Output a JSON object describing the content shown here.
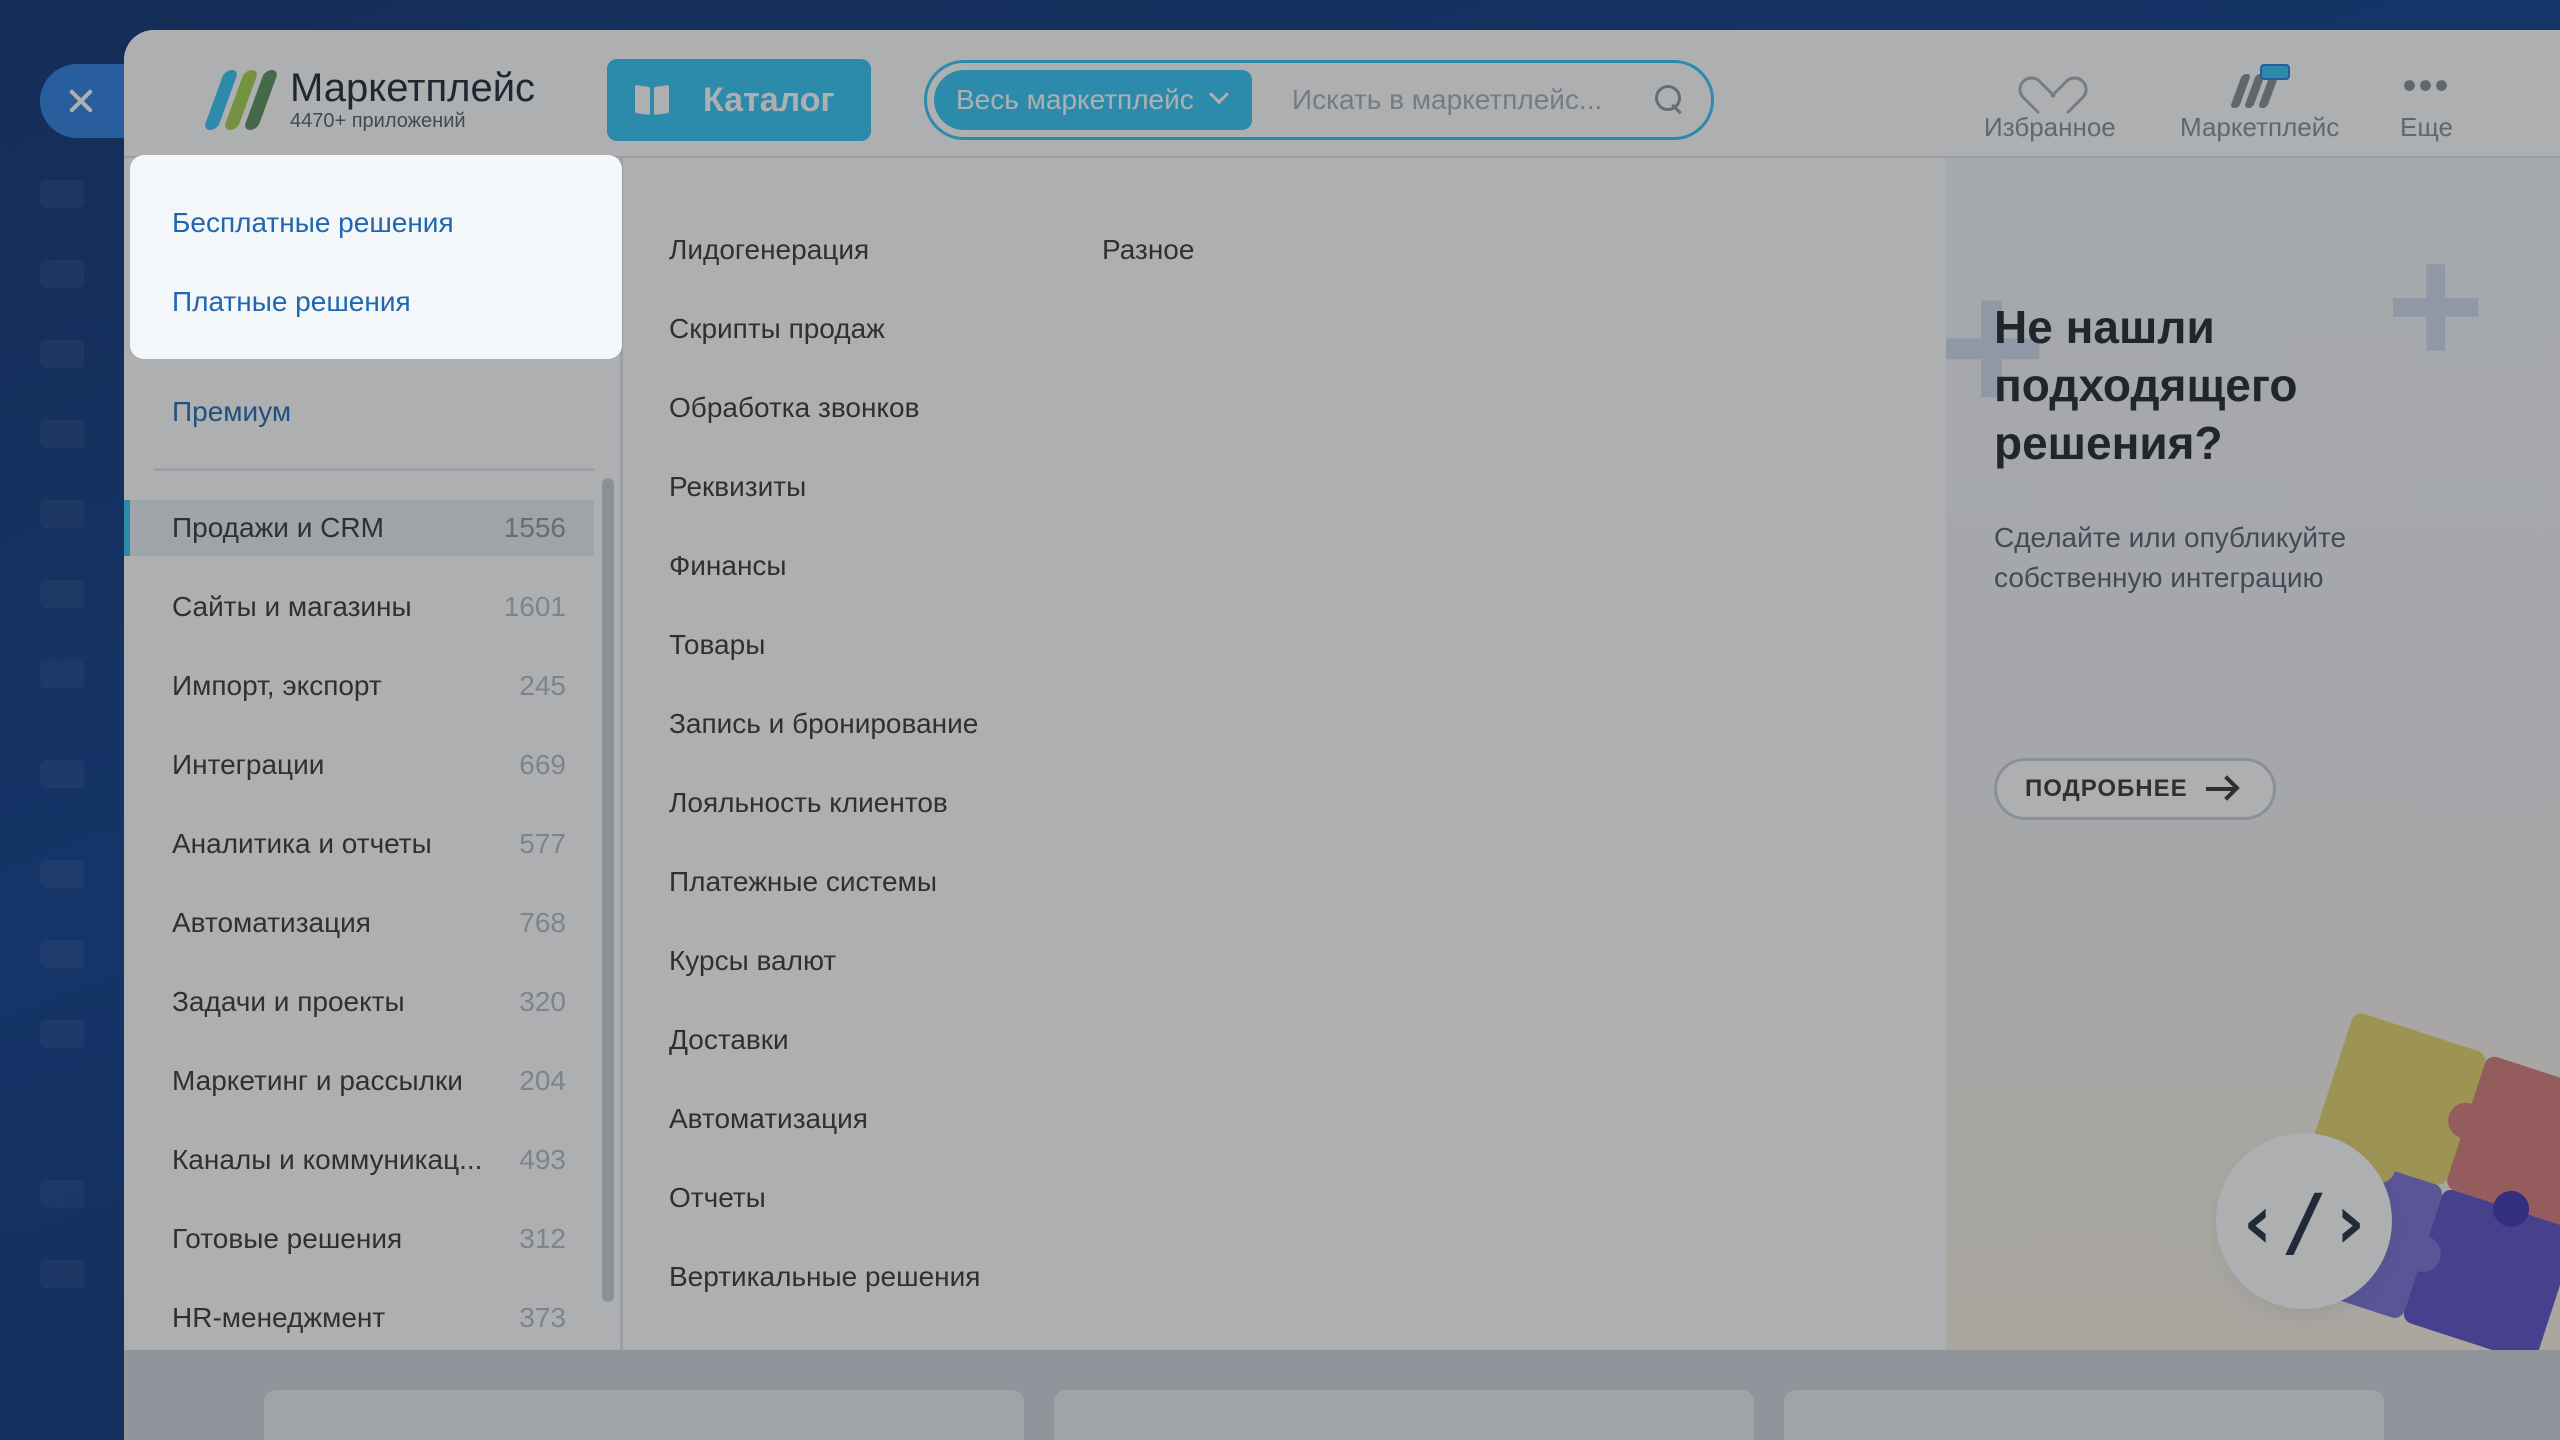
{
  "close": {
    "label": "✕"
  },
  "header": {
    "logo_title": "Маркетплейс",
    "logo_sub": "4470+ приложений",
    "catalog_label": "Каталог",
    "search_scope": "Весь маркетплейс",
    "search_placeholder": "Искать в маркетплейс...",
    "favorites": "Избранное",
    "marketplace": "Маркетплейс",
    "more": "Еще"
  },
  "filters": {
    "free": "Бесплатные решения",
    "paid": "Платные решения",
    "premium": "Премиум"
  },
  "categories": [
    {
      "label": "Продажи и CRM",
      "count": "1556"
    },
    {
      "label": "Сайты и магазины",
      "count": "1601"
    },
    {
      "label": "Импорт, экспорт",
      "count": "245"
    },
    {
      "label": "Интеграции",
      "count": "669"
    },
    {
      "label": "Аналитика и отчеты",
      "count": "577"
    },
    {
      "label": "Автоматизация",
      "count": "768"
    },
    {
      "label": "Задачи и проекты",
      "count": "320"
    },
    {
      "label": "Маркетинг и рассылки",
      "count": "204"
    },
    {
      "label": "Каналы и коммуникац...",
      "count": "493"
    },
    {
      "label": "Готовые решения",
      "count": "312"
    },
    {
      "label": "HR-менеджмент",
      "count": "373"
    }
  ],
  "subcategories_col1": [
    "Лидогенерация",
    "Скрипты продаж",
    "Обработка звонков",
    "Реквизиты",
    "Финансы",
    "Товары",
    "Запись и бронирование",
    "Лояльность клиентов",
    "Платежные системы",
    "Курсы валют",
    "Доставки",
    "Автоматизация",
    "Отчеты",
    "Вертикальные решения"
  ],
  "subcategories_col2": [
    "Разное"
  ],
  "promo": {
    "title": "Не нашли подходящего решения?",
    "text": "Сделайте или опубликуйте собственную интеграцию",
    "button": "ПОДРОБНЕЕ",
    "badge": "‹/›"
  },
  "colors": {
    "accent": "#2fc6f6",
    "link": "#2067b0",
    "background": "#0a3a8a"
  },
  "icons": [
    "close-icon",
    "logo-icon",
    "book-icon",
    "chevron-down-icon",
    "search-icon",
    "heart-icon",
    "marketplace-icon",
    "more-dots-icon",
    "arrow-right-icon",
    "code-icon"
  ]
}
